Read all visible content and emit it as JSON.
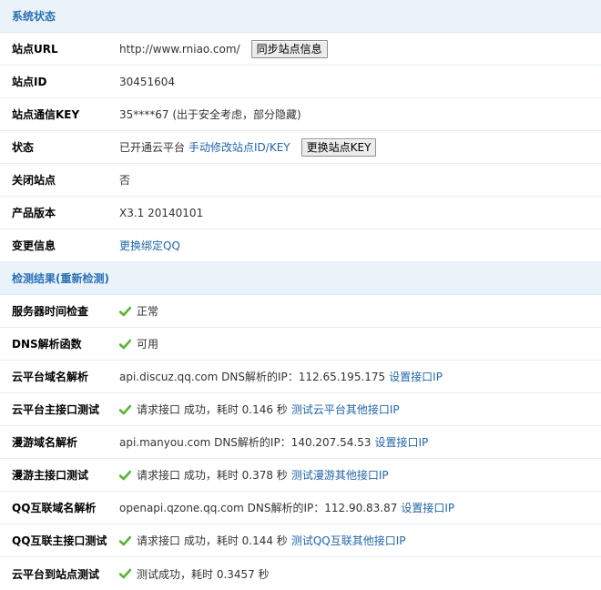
{
  "section1": {
    "title": "系统状态",
    "site_url": {
      "label": "站点URL",
      "value": "http://www.rniao.com/",
      "button": "同步站点信息"
    },
    "site_id": {
      "label": "站点ID",
      "value": "30451604"
    },
    "site_key": {
      "label": "站点通信KEY",
      "value": "35****67 (出于安全考虑，部分隐藏)"
    },
    "status": {
      "label": "状态",
      "value": "已开通云平台",
      "link": "手动修改站点ID/KEY",
      "button": "更换站点KEY"
    },
    "close_site": {
      "label": "关闭站点",
      "value": "否"
    },
    "version": {
      "label": "产品版本",
      "value": "X3.1 20140101"
    },
    "change_info": {
      "label": "变更信息",
      "link": "更换绑定QQ"
    }
  },
  "section2": {
    "title": "检测结果(重新检测)",
    "server_time": {
      "label": "服务器时间检查",
      "value": "正常"
    },
    "dns_func": {
      "label": "DNS解析函数",
      "value": "可用"
    },
    "cloud_dns": {
      "label": "云平台域名解析",
      "value": "api.discuz.qq.com DNS解析的IP：112.65.195.175",
      "link": "设置接口IP"
    },
    "cloud_api": {
      "label": "云平台主接口测试",
      "value": "请求接口 成功，耗时 0.146 秒",
      "link": "测试云平台其他接口IP"
    },
    "manyou_dns": {
      "label": "漫游域名解析",
      "value": "api.manyou.com DNS解析的IP：140.207.54.53",
      "link": "设置接口IP"
    },
    "manyou_api": {
      "label": "漫游主接口测试",
      "value": "请求接口 成功，耗时 0.378 秒",
      "link": "测试漫游其他接口IP"
    },
    "qq_dns": {
      "label": "QQ互联域名解析",
      "value": "openapi.qzone.qq.com DNS解析的IP：112.90.83.87",
      "link": "设置接口IP"
    },
    "qq_api": {
      "label": "QQ互联主接口测试",
      "value": "请求接口 成功，耗时 0.144 秒",
      "link": "测试QQ互联其他接口IP"
    },
    "cloud_to_site": {
      "label": "云平台到站点测试",
      "value": "测试成功，耗时 0.3457 秒"
    }
  },
  "colors": {
    "header_bg": "#eaf3fa",
    "header_text": "#2b6fb6",
    "link": "#2366a8",
    "check": "#5ab435"
  }
}
